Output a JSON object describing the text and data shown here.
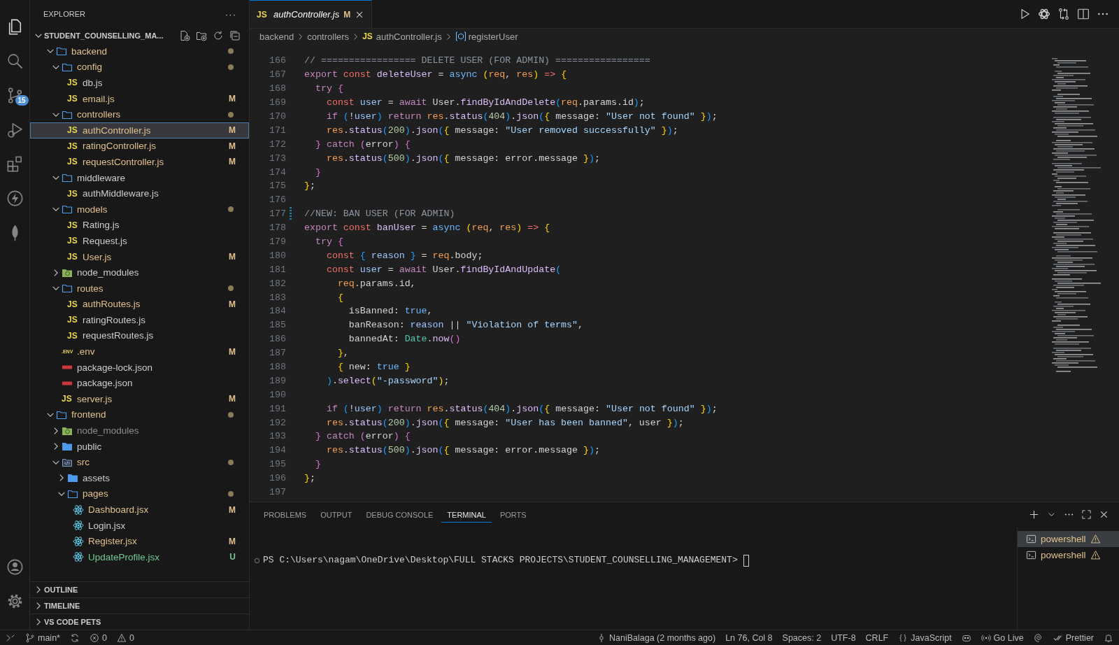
{
  "activity_bar": {
    "items": [
      {
        "kind": "files",
        "selected": true
      },
      {
        "kind": "search",
        "selected": false
      },
      {
        "kind": "source-control",
        "selected": false,
        "badge": "15"
      },
      {
        "kind": "run-debug",
        "selected": false
      },
      {
        "kind": "extensions",
        "selected": false
      },
      {
        "kind": "lightning",
        "selected": false
      },
      {
        "kind": "leaf",
        "selected": false
      }
    ],
    "bottom": [
      {
        "kind": "account"
      },
      {
        "kind": "settings"
      }
    ]
  },
  "sidebar": {
    "title": "EXPLORER",
    "more": "···",
    "project": {
      "name": "STUDENT_COUNSELLING_MA...",
      "expanded": true
    },
    "tree": [
      {
        "name": "backend",
        "kind": "folder",
        "color": "#e2c08d",
        "dot": true,
        "expanded": true,
        "selected": false,
        "children": [
          {
            "name": "config",
            "kind": "folder",
            "color": "#e2c08d",
            "dot": true,
            "expanded": true,
            "selected": false,
            "children": [
              {
                "name": "db.js",
                "kind": "js",
                "icon_text": "JS",
                "color": "#cccccc",
                "selected": false
              },
              {
                "name": "email.js",
                "kind": "js",
                "icon_text": "JS",
                "color": "#e2c08d",
                "badge": "M",
                "selected": false
              }
            ]
          },
          {
            "name": "controllers",
            "kind": "folder",
            "color": "#e2c08d",
            "dot": true,
            "expanded": true,
            "selected": false,
            "children": [
              {
                "name": "authController.js",
                "kind": "js",
                "icon_text": "JS",
                "color": "#e2c08d",
                "badge": "M",
                "selected": true
              },
              {
                "name": "ratingController.js",
                "kind": "js",
                "icon_text": "JS",
                "color": "#e2c08d",
                "badge": "M",
                "selected": false
              },
              {
                "name": "requestController.js",
                "kind": "js",
                "icon_text": "JS",
                "color": "#e2c08d",
                "badge": "M",
                "selected": false
              }
            ]
          },
          {
            "name": "middleware",
            "kind": "folder",
            "color": "#cccccc",
            "dot": false,
            "expanded": true,
            "selected": false,
            "children": [
              {
                "name": "authMiddleware.js",
                "kind": "js",
                "icon_text": "JS",
                "color": "#cccccc",
                "selected": false
              }
            ]
          },
          {
            "name": "models",
            "kind": "folder",
            "color": "#e2c08d",
            "dot": true,
            "expanded": true,
            "selected": false,
            "children": [
              {
                "name": "Rating.js",
                "kind": "js",
                "icon_text": "JS",
                "color": "#cccccc",
                "selected": false
              },
              {
                "name": "Request.js",
                "kind": "js",
                "icon_text": "JS",
                "color": "#cccccc",
                "selected": false
              },
              {
                "name": "User.js",
                "kind": "js",
                "icon_text": "JS",
                "color": "#e2c08d",
                "badge": "M",
                "selected": false
              }
            ]
          },
          {
            "name": "node_modules",
            "kind": "folder-node",
            "color": "#cccccc",
            "dot": false,
            "expanded": false,
            "selected": false
          },
          {
            "name": "routes",
            "kind": "folder",
            "color": "#e2c08d",
            "dot": true,
            "expanded": true,
            "selected": false,
            "children": [
              {
                "name": "authRoutes.js",
                "kind": "js",
                "icon_text": "JS",
                "color": "#e2c08d",
                "badge": "M",
                "selected": false
              },
              {
                "name": "ratingRoutes.js",
                "kind": "js",
                "icon_text": "JS",
                "color": "#cccccc",
                "selected": false
              },
              {
                "name": "requestRoutes.js",
                "kind": "js",
                "icon_text": "JS",
                "color": "#cccccc",
                "selected": false
              }
            ]
          },
          {
            "name": ".env",
            "kind": "env",
            "icon_text": ".ENV",
            "color": "#e2c08d",
            "badge": "M",
            "selected": false
          },
          {
            "name": "package-lock.json",
            "kind": "npm",
            "color": "#cccccc",
            "selected": false
          },
          {
            "name": "package.json",
            "kind": "npm",
            "color": "#cccccc",
            "selected": false
          },
          {
            "name": "server.js",
            "kind": "js",
            "icon_text": "JS",
            "color": "#e2c08d",
            "badge": "M",
            "selected": false
          }
        ]
      },
      {
        "name": "frontend",
        "kind": "folder",
        "color": "#e2c08d",
        "dot": true,
        "expanded": true,
        "selected": false,
        "children": [
          {
            "name": "node_modules",
            "kind": "folder-node",
            "color": "#8c8c8c",
            "dot": false,
            "expanded": false,
            "selected": false
          },
          {
            "name": "public",
            "kind": "folder-solid",
            "color": "#cccccc",
            "dot": false,
            "expanded": false,
            "selected": false
          },
          {
            "name": "src",
            "kind": "folder-src",
            "color": "#e2c08d",
            "dot": true,
            "expanded": true,
            "selected": false,
            "children": [
              {
                "name": "assets",
                "kind": "folder-solid",
                "color": "#cccccc",
                "dot": false,
                "expanded": false,
                "selected": false
              },
              {
                "name": "pages",
                "kind": "folder",
                "color": "#e2c08d",
                "dot": true,
                "expanded": true,
                "selected": false,
                "children": [
                  {
                    "name": "Dashboard.jsx",
                    "kind": "react",
                    "color": "#e2c08d",
                    "badge": "M",
                    "selected": false
                  },
                  {
                    "name": "Login.jsx",
                    "kind": "react",
                    "color": "#cccccc",
                    "selected": false
                  },
                  {
                    "name": "Register.jsx",
                    "kind": "react",
                    "color": "#e2c08d",
                    "badge": "M",
                    "selected": false
                  },
                  {
                    "name": "UpdateProfile.jsx",
                    "kind": "react",
                    "color": "#73c991",
                    "badge": "U",
                    "selected": false
                  }
                ]
              }
            ]
          }
        ]
      }
    ],
    "sections": [
      {
        "title": "OUTLINE",
        "expanded": false
      },
      {
        "title": "TIMELINE",
        "expanded": false
      },
      {
        "title": "VS CODE PETS",
        "expanded": false
      }
    ]
  },
  "editor": {
    "tabs": [
      {
        "title": "authController.js",
        "kind": "js",
        "icon_text": "JS",
        "badge": "M",
        "selected": true
      }
    ],
    "breadcrumb": [
      {
        "text": "backend"
      },
      {
        "text": "controllers"
      },
      {
        "kind": "js",
        "icon_text": "JS",
        "text": "authController.js"
      },
      {
        "kind": "symbol",
        "text": "registerUser"
      }
    ],
    "lines": [
      {
        "number": "166",
        "changed": false,
        "tokens": [
          {
            "kind": "comment",
            "text": "// ================= DELETE USER (FOR ADMIN) ================="
          }
        ]
      },
      {
        "number": "167",
        "changed": false,
        "tokens": [
          {
            "kind": "kw",
            "text": "export "
          },
          {
            "kind": "decl",
            "text": "const "
          },
          {
            "kind": "fn",
            "text": "deleteUser"
          },
          {
            "kind": "plain",
            "text": " = "
          },
          {
            "kind": "const",
            "text": "async "
          },
          {
            "kind": "b1",
            "text": "("
          },
          {
            "kind": "param",
            "text": "req"
          },
          {
            "kind": "plain",
            "text": ", "
          },
          {
            "kind": "param",
            "text": "res"
          },
          {
            "kind": "b1",
            "text": ")"
          },
          {
            "kind": "decl",
            "text": " => "
          },
          {
            "kind": "b1",
            "text": "{"
          }
        ]
      },
      {
        "number": "168",
        "changed": false,
        "tokens": [
          {
            "kind": "kw",
            "text": "  try "
          },
          {
            "kind": "b2",
            "text": "{"
          }
        ]
      },
      {
        "number": "169",
        "changed": false,
        "tokens": [
          {
            "kind": "decl",
            "text": "    const "
          },
          {
            "kind": "var",
            "text": "user"
          },
          {
            "kind": "plain",
            "text": " = "
          },
          {
            "kind": "kw",
            "text": "await"
          },
          {
            "kind": "plain",
            "text": " User."
          },
          {
            "kind": "fn",
            "text": "findByIdAndDelete"
          },
          {
            "kind": "b3",
            "text": "("
          },
          {
            "kind": "param",
            "text": "req"
          },
          {
            "kind": "plain",
            "text": ".params.id"
          },
          {
            "kind": "b3",
            "text": ")"
          },
          {
            "kind": "plain",
            "text": ";"
          }
        ]
      },
      {
        "number": "170",
        "changed": false,
        "tokens": [
          {
            "kind": "kw",
            "text": "    if "
          },
          {
            "kind": "b3",
            "text": "("
          },
          {
            "kind": "plain",
            "text": "!"
          },
          {
            "kind": "var",
            "text": "user"
          },
          {
            "kind": "b3",
            "text": ")"
          },
          {
            "kind": "kw",
            "text": " return "
          },
          {
            "kind": "param",
            "text": "res"
          },
          {
            "kind": "plain",
            "text": "."
          },
          {
            "kind": "fn",
            "text": "status"
          },
          {
            "kind": "b3",
            "text": "("
          },
          {
            "kind": "num",
            "text": "404"
          },
          {
            "kind": "b3",
            "text": ")"
          },
          {
            "kind": "plain",
            "text": "."
          },
          {
            "kind": "fn",
            "text": "json"
          },
          {
            "kind": "b3",
            "text": "("
          },
          {
            "kind": "b1",
            "text": "{"
          },
          {
            "kind": "plain",
            "text": " message: "
          },
          {
            "kind": "str",
            "text": "\"User not found\""
          },
          {
            "kind": "b1",
            "text": " }"
          },
          {
            "kind": "b3",
            "text": ")"
          },
          {
            "kind": "plain",
            "text": ";"
          }
        ]
      },
      {
        "number": "171",
        "changed": false,
        "tokens": [
          {
            "kind": "param",
            "text": "    res"
          },
          {
            "kind": "plain",
            "text": "."
          },
          {
            "kind": "fn",
            "text": "status"
          },
          {
            "kind": "b3",
            "text": "("
          },
          {
            "kind": "num",
            "text": "200"
          },
          {
            "kind": "b3",
            "text": ")"
          },
          {
            "kind": "plain",
            "text": "."
          },
          {
            "kind": "fn",
            "text": "json"
          },
          {
            "kind": "b3",
            "text": "("
          },
          {
            "kind": "b1",
            "text": "{"
          },
          {
            "kind": "plain",
            "text": " message: "
          },
          {
            "kind": "str",
            "text": "\"User removed successfully\""
          },
          {
            "kind": "b1",
            "text": " }"
          },
          {
            "kind": "b3",
            "text": ")"
          },
          {
            "kind": "plain",
            "text": ";"
          }
        ]
      },
      {
        "number": "172",
        "changed": false,
        "tokens": [
          {
            "kind": "b2",
            "text": "  }"
          },
          {
            "kind": "kw",
            "text": " catch "
          },
          {
            "kind": "b2",
            "text": "("
          },
          {
            "kind": "plain",
            "text": "error"
          },
          {
            "kind": "b2",
            "text": ")"
          },
          {
            "kind": "b2",
            "text": " {"
          }
        ]
      },
      {
        "number": "173",
        "changed": false,
        "tokens": [
          {
            "kind": "param",
            "text": "    res"
          },
          {
            "kind": "plain",
            "text": "."
          },
          {
            "kind": "fn",
            "text": "status"
          },
          {
            "kind": "b3",
            "text": "("
          },
          {
            "kind": "num",
            "text": "500"
          },
          {
            "kind": "b3",
            "text": ")"
          },
          {
            "kind": "plain",
            "text": "."
          },
          {
            "kind": "fn",
            "text": "json"
          },
          {
            "kind": "b3",
            "text": "("
          },
          {
            "kind": "b1",
            "text": "{"
          },
          {
            "kind": "plain",
            "text": " message: error.message "
          },
          {
            "kind": "b1",
            "text": "}"
          },
          {
            "kind": "b3",
            "text": ")"
          },
          {
            "kind": "plain",
            "text": ";"
          }
        ]
      },
      {
        "number": "174",
        "changed": false,
        "tokens": [
          {
            "kind": "b2",
            "text": "  }"
          }
        ]
      },
      {
        "number": "175",
        "changed": false,
        "tokens": [
          {
            "kind": "b1",
            "text": "}"
          },
          {
            "kind": "plain",
            "text": ";"
          }
        ]
      },
      {
        "number": "176",
        "changed": false
      },
      {
        "number": "177",
        "changed": true,
        "tokens": [
          {
            "kind": "comment",
            "text": "//NEW: BAN USER (FOR ADMIN)"
          }
        ]
      },
      {
        "number": "178",
        "changed": false,
        "tokens": [
          {
            "kind": "kw",
            "text": "export "
          },
          {
            "kind": "decl",
            "text": "const "
          },
          {
            "kind": "fn",
            "text": "banUser"
          },
          {
            "kind": "plain",
            "text": " = "
          },
          {
            "kind": "const",
            "text": "async "
          },
          {
            "kind": "b1",
            "text": "("
          },
          {
            "kind": "param",
            "text": "req"
          },
          {
            "kind": "plain",
            "text": ", "
          },
          {
            "kind": "param",
            "text": "res"
          },
          {
            "kind": "b1",
            "text": ")"
          },
          {
            "kind": "decl",
            "text": " => "
          },
          {
            "kind": "b1",
            "text": "{"
          }
        ]
      },
      {
        "number": "179",
        "changed": false,
        "tokens": [
          {
            "kind": "kw",
            "text": "  try "
          },
          {
            "kind": "b2",
            "text": "{"
          }
        ]
      },
      {
        "number": "180",
        "changed": false,
        "tokens": [
          {
            "kind": "decl",
            "text": "    const "
          },
          {
            "kind": "b3",
            "text": "{ "
          },
          {
            "kind": "var",
            "text": "reason"
          },
          {
            "kind": "b3",
            "text": " }"
          },
          {
            "kind": "plain",
            "text": " = "
          },
          {
            "kind": "param",
            "text": "req"
          },
          {
            "kind": "plain",
            "text": ".body;"
          }
        ]
      },
      {
        "number": "181",
        "changed": false,
        "tokens": [
          {
            "kind": "decl",
            "text": "    const "
          },
          {
            "kind": "var",
            "text": "user"
          },
          {
            "kind": "plain",
            "text": " = "
          },
          {
            "kind": "kw",
            "text": "await"
          },
          {
            "kind": "plain",
            "text": " User."
          },
          {
            "kind": "fn",
            "text": "findByIdAndUpdate"
          },
          {
            "kind": "b3",
            "text": "("
          }
        ]
      },
      {
        "number": "182",
        "changed": false,
        "tokens": [
          {
            "kind": "param",
            "text": "      req"
          },
          {
            "kind": "plain",
            "text": ".params.id,"
          }
        ]
      },
      {
        "number": "183",
        "changed": false,
        "tokens": [
          {
            "kind": "b1",
            "text": "      {"
          }
        ]
      },
      {
        "number": "184",
        "changed": false,
        "tokens": [
          {
            "kind": "plain",
            "text": "        isBanned: "
          },
          {
            "kind": "const",
            "text": "true"
          },
          {
            "kind": "plain",
            "text": ","
          }
        ]
      },
      {
        "number": "185",
        "changed": false,
        "tokens": [
          {
            "kind": "plain",
            "text": "        banReason: "
          },
          {
            "kind": "var",
            "text": "reason"
          },
          {
            "kind": "plain",
            "text": " || "
          },
          {
            "kind": "str",
            "text": "\"Violation of terms\""
          },
          {
            "kind": "plain",
            "text": ","
          }
        ]
      },
      {
        "number": "186",
        "changed": false,
        "tokens": [
          {
            "kind": "plain",
            "text": "        bannedAt: "
          },
          {
            "kind": "cls",
            "text": "Date"
          },
          {
            "kind": "plain",
            "text": "."
          },
          {
            "kind": "fn",
            "text": "now"
          },
          {
            "kind": "b2",
            "text": "()"
          }
        ]
      },
      {
        "number": "187",
        "changed": false,
        "tokens": [
          {
            "kind": "b1",
            "text": "      }"
          },
          {
            "kind": "plain",
            "text": ","
          }
        ]
      },
      {
        "number": "188",
        "changed": false,
        "tokens": [
          {
            "kind": "b1",
            "text": "      { "
          },
          {
            "kind": "plain",
            "text": "new: "
          },
          {
            "kind": "const",
            "text": "true"
          },
          {
            "kind": "b1",
            "text": " }"
          }
        ]
      },
      {
        "number": "189",
        "changed": false,
        "tokens": [
          {
            "kind": "b3",
            "text": "    )"
          },
          {
            "kind": "plain",
            "text": "."
          },
          {
            "kind": "fn",
            "text": "select"
          },
          {
            "kind": "b1",
            "text": "("
          },
          {
            "kind": "str",
            "text": "\"-password\""
          },
          {
            "kind": "b1",
            "text": ")"
          },
          {
            "kind": "plain",
            "text": ";"
          }
        ]
      },
      {
        "number": "190",
        "changed": false
      },
      {
        "number": "191",
        "changed": false,
        "tokens": [
          {
            "kind": "kw",
            "text": "    if "
          },
          {
            "kind": "b3",
            "text": "("
          },
          {
            "kind": "plain",
            "text": "!"
          },
          {
            "kind": "var",
            "text": "user"
          },
          {
            "kind": "b3",
            "text": ")"
          },
          {
            "kind": "kw",
            "text": " return "
          },
          {
            "kind": "param",
            "text": "res"
          },
          {
            "kind": "plain",
            "text": "."
          },
          {
            "kind": "fn",
            "text": "status"
          },
          {
            "kind": "b3",
            "text": "("
          },
          {
            "kind": "num",
            "text": "404"
          },
          {
            "kind": "b3",
            "text": ")"
          },
          {
            "kind": "plain",
            "text": "."
          },
          {
            "kind": "fn",
            "text": "json"
          },
          {
            "kind": "b3",
            "text": "("
          },
          {
            "kind": "b1",
            "text": "{"
          },
          {
            "kind": "plain",
            "text": " message: "
          },
          {
            "kind": "str",
            "text": "\"User not found\""
          },
          {
            "kind": "b1",
            "text": " }"
          },
          {
            "kind": "b3",
            "text": ")"
          },
          {
            "kind": "plain",
            "text": ";"
          }
        ]
      },
      {
        "number": "192",
        "changed": false,
        "tokens": [
          {
            "kind": "param",
            "text": "    res"
          },
          {
            "kind": "plain",
            "text": "."
          },
          {
            "kind": "fn",
            "text": "status"
          },
          {
            "kind": "b3",
            "text": "("
          },
          {
            "kind": "num",
            "text": "200"
          },
          {
            "kind": "b3",
            "text": ")"
          },
          {
            "kind": "plain",
            "text": "."
          },
          {
            "kind": "fn",
            "text": "json"
          },
          {
            "kind": "b3",
            "text": "("
          },
          {
            "kind": "b1",
            "text": "{"
          },
          {
            "kind": "plain",
            "text": " message: "
          },
          {
            "kind": "str",
            "text": "\"User has been banned\""
          },
          {
            "kind": "plain",
            "text": ", user "
          },
          {
            "kind": "b1",
            "text": "}"
          },
          {
            "kind": "b3",
            "text": ")"
          },
          {
            "kind": "plain",
            "text": ";"
          }
        ]
      },
      {
        "number": "193",
        "changed": false,
        "tokens": [
          {
            "kind": "b2",
            "text": "  }"
          },
          {
            "kind": "kw",
            "text": " catch "
          },
          {
            "kind": "b2",
            "text": "("
          },
          {
            "kind": "plain",
            "text": "error"
          },
          {
            "kind": "b2",
            "text": ")"
          },
          {
            "kind": "b2",
            "text": " {"
          }
        ]
      },
      {
        "number": "194",
        "changed": false,
        "tokens": [
          {
            "kind": "param",
            "text": "    res"
          },
          {
            "kind": "plain",
            "text": "."
          },
          {
            "kind": "fn",
            "text": "status"
          },
          {
            "kind": "b3",
            "text": "("
          },
          {
            "kind": "num",
            "text": "500"
          },
          {
            "kind": "b3",
            "text": ")"
          },
          {
            "kind": "plain",
            "text": "."
          },
          {
            "kind": "fn",
            "text": "json"
          },
          {
            "kind": "b3",
            "text": "("
          },
          {
            "kind": "b1",
            "text": "{"
          },
          {
            "kind": "plain",
            "text": " message: error.message "
          },
          {
            "kind": "b1",
            "text": "}"
          },
          {
            "kind": "b3",
            "text": ")"
          },
          {
            "kind": "plain",
            "text": ";"
          }
        ]
      },
      {
        "number": "195",
        "changed": false,
        "tokens": [
          {
            "kind": "b2",
            "text": "  }"
          }
        ]
      },
      {
        "number": "196",
        "changed": false,
        "tokens": [
          {
            "kind": "b1",
            "text": "}"
          },
          {
            "kind": "plain",
            "text": ";"
          }
        ]
      },
      {
        "number": "197",
        "changed": false
      }
    ]
  },
  "panel": {
    "tabs": [
      {
        "label": "PROBLEMS",
        "selected": false
      },
      {
        "label": "OUTPUT",
        "selected": false
      },
      {
        "label": "DEBUG CONSOLE",
        "selected": false
      },
      {
        "label": "TERMINAL",
        "selected": true
      },
      {
        "label": "PORTS",
        "selected": false
      }
    ],
    "terminal": {
      "prompt": "PS C:\\Users\\nagam\\OneDrive\\Desktop\\FULL STACKS PROJECTS\\STUDENT_COUNSELLING_MANAGEMENT>"
    },
    "terminals": [
      {
        "name": "powershell",
        "selected": true
      },
      {
        "name": "powershell",
        "selected": false
      }
    ]
  },
  "status_bar": {
    "left": [
      {
        "kind": "remote"
      },
      {
        "kind": "branch",
        "text": "main*"
      },
      {
        "kind": "sync"
      },
      {
        "kind": "error",
        "text": "0"
      },
      {
        "kind": "warning",
        "text": "0"
      }
    ],
    "right": [
      {
        "kind": "commit",
        "text": "NaniBalaga (2 months ago)"
      },
      {
        "text": "Ln 76, Col 8"
      },
      {
        "text": "Spaces: 2"
      },
      {
        "text": "UTF-8"
      },
      {
        "text": "CRLF"
      },
      {
        "kind": "braces",
        "text": "JavaScript"
      },
      {
        "kind": "robot"
      },
      {
        "kind": "broadcast",
        "text": "Go Live"
      },
      {
        "kind": "swirl"
      },
      {
        "kind": "double-check",
        "text": "Prettier"
      },
      {
        "kind": "bell"
      }
    ]
  }
}
